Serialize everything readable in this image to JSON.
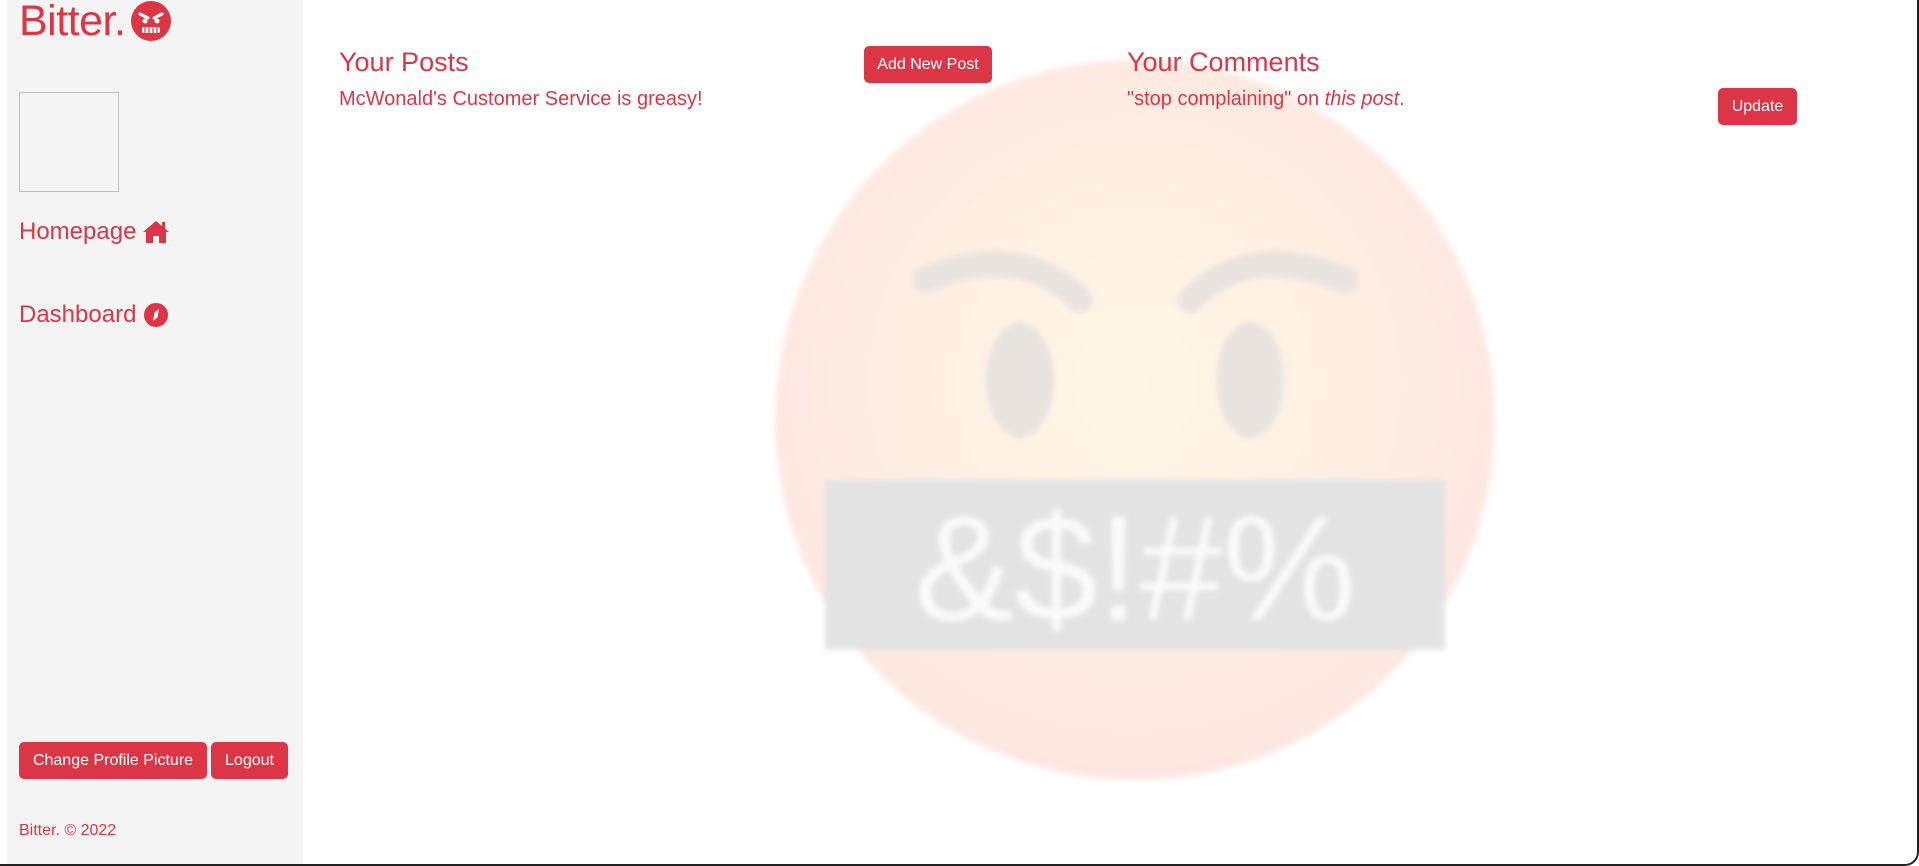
{
  "sidebar": {
    "brand": "Bitter.",
    "brand_icon": "angry-face-icon",
    "nav": [
      {
        "label": "Homepage",
        "icon": "home-icon"
      },
      {
        "label": "Dashboard",
        "icon": "compass-icon"
      }
    ],
    "buttons": {
      "change_profile_picture": "Change Profile Picture",
      "logout": "Logout"
    },
    "footer": "Bitter. © 2022"
  },
  "posts": {
    "title": "Your Posts",
    "add_button": "Add New Post",
    "items": [
      {
        "title": "McWonald's Customer Service is greasy!"
      }
    ]
  },
  "comments": {
    "title": "Your Comments",
    "items": [
      {
        "quote": "\"stop complaining\"",
        "on_text": " on ",
        "link": "this post",
        "end": ".",
        "button": "Update"
      }
    ]
  },
  "watermark": {
    "icon": "angry-censored-face-icon",
    "symbols": "&$!#%"
  },
  "colors": {
    "accent": "#dc3545",
    "sidebar_bg": "#f4f4f4"
  }
}
